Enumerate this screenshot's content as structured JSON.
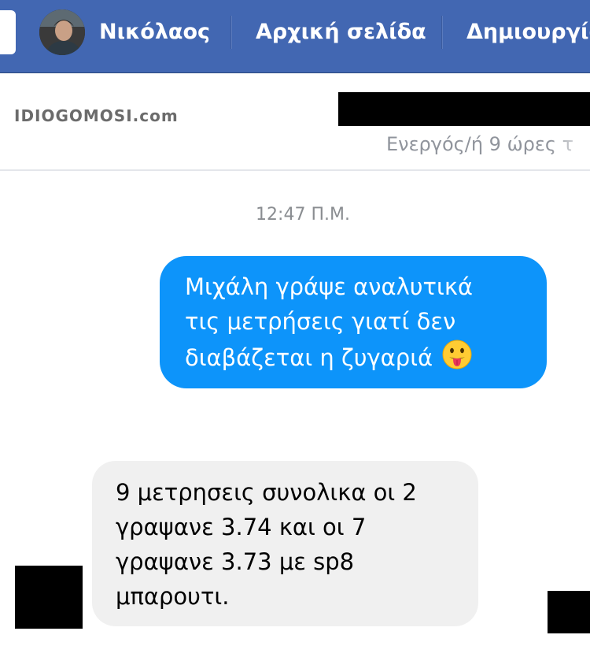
{
  "topbar": {
    "profile_name": "Νικόλαος",
    "home_label": "Αρχική σελίδα",
    "create_label": "Δημιουργία"
  },
  "header": {
    "watermark": "IDIOGOMOSI.com",
    "active_status": "Ενεργός/ή 9 ώρες τ"
  },
  "conversation": {
    "timestamp": "12:47 Π.Μ.",
    "messages": [
      {
        "direction": "outgoing",
        "lines": [
          "Μιχάλη γράψε αναλυτικά",
          "τις μετρήσεις γιατί δεν",
          "διαβάζεται η ζυγαριά"
        ],
        "emoji": "tongue-out-emoji"
      },
      {
        "direction": "incoming",
        "lines": [
          "9 μετρησεις συνολικα οι 2",
          "γραψανε 3.74 και οι 7",
          "γραψανε 3.73 με sp8",
          "μπαρουτι."
        ]
      }
    ]
  },
  "colors": {
    "topbar_bg": "#4267b2",
    "outgoing_bubble": "#0d94fa",
    "incoming_bubble": "#f0f0f0"
  }
}
